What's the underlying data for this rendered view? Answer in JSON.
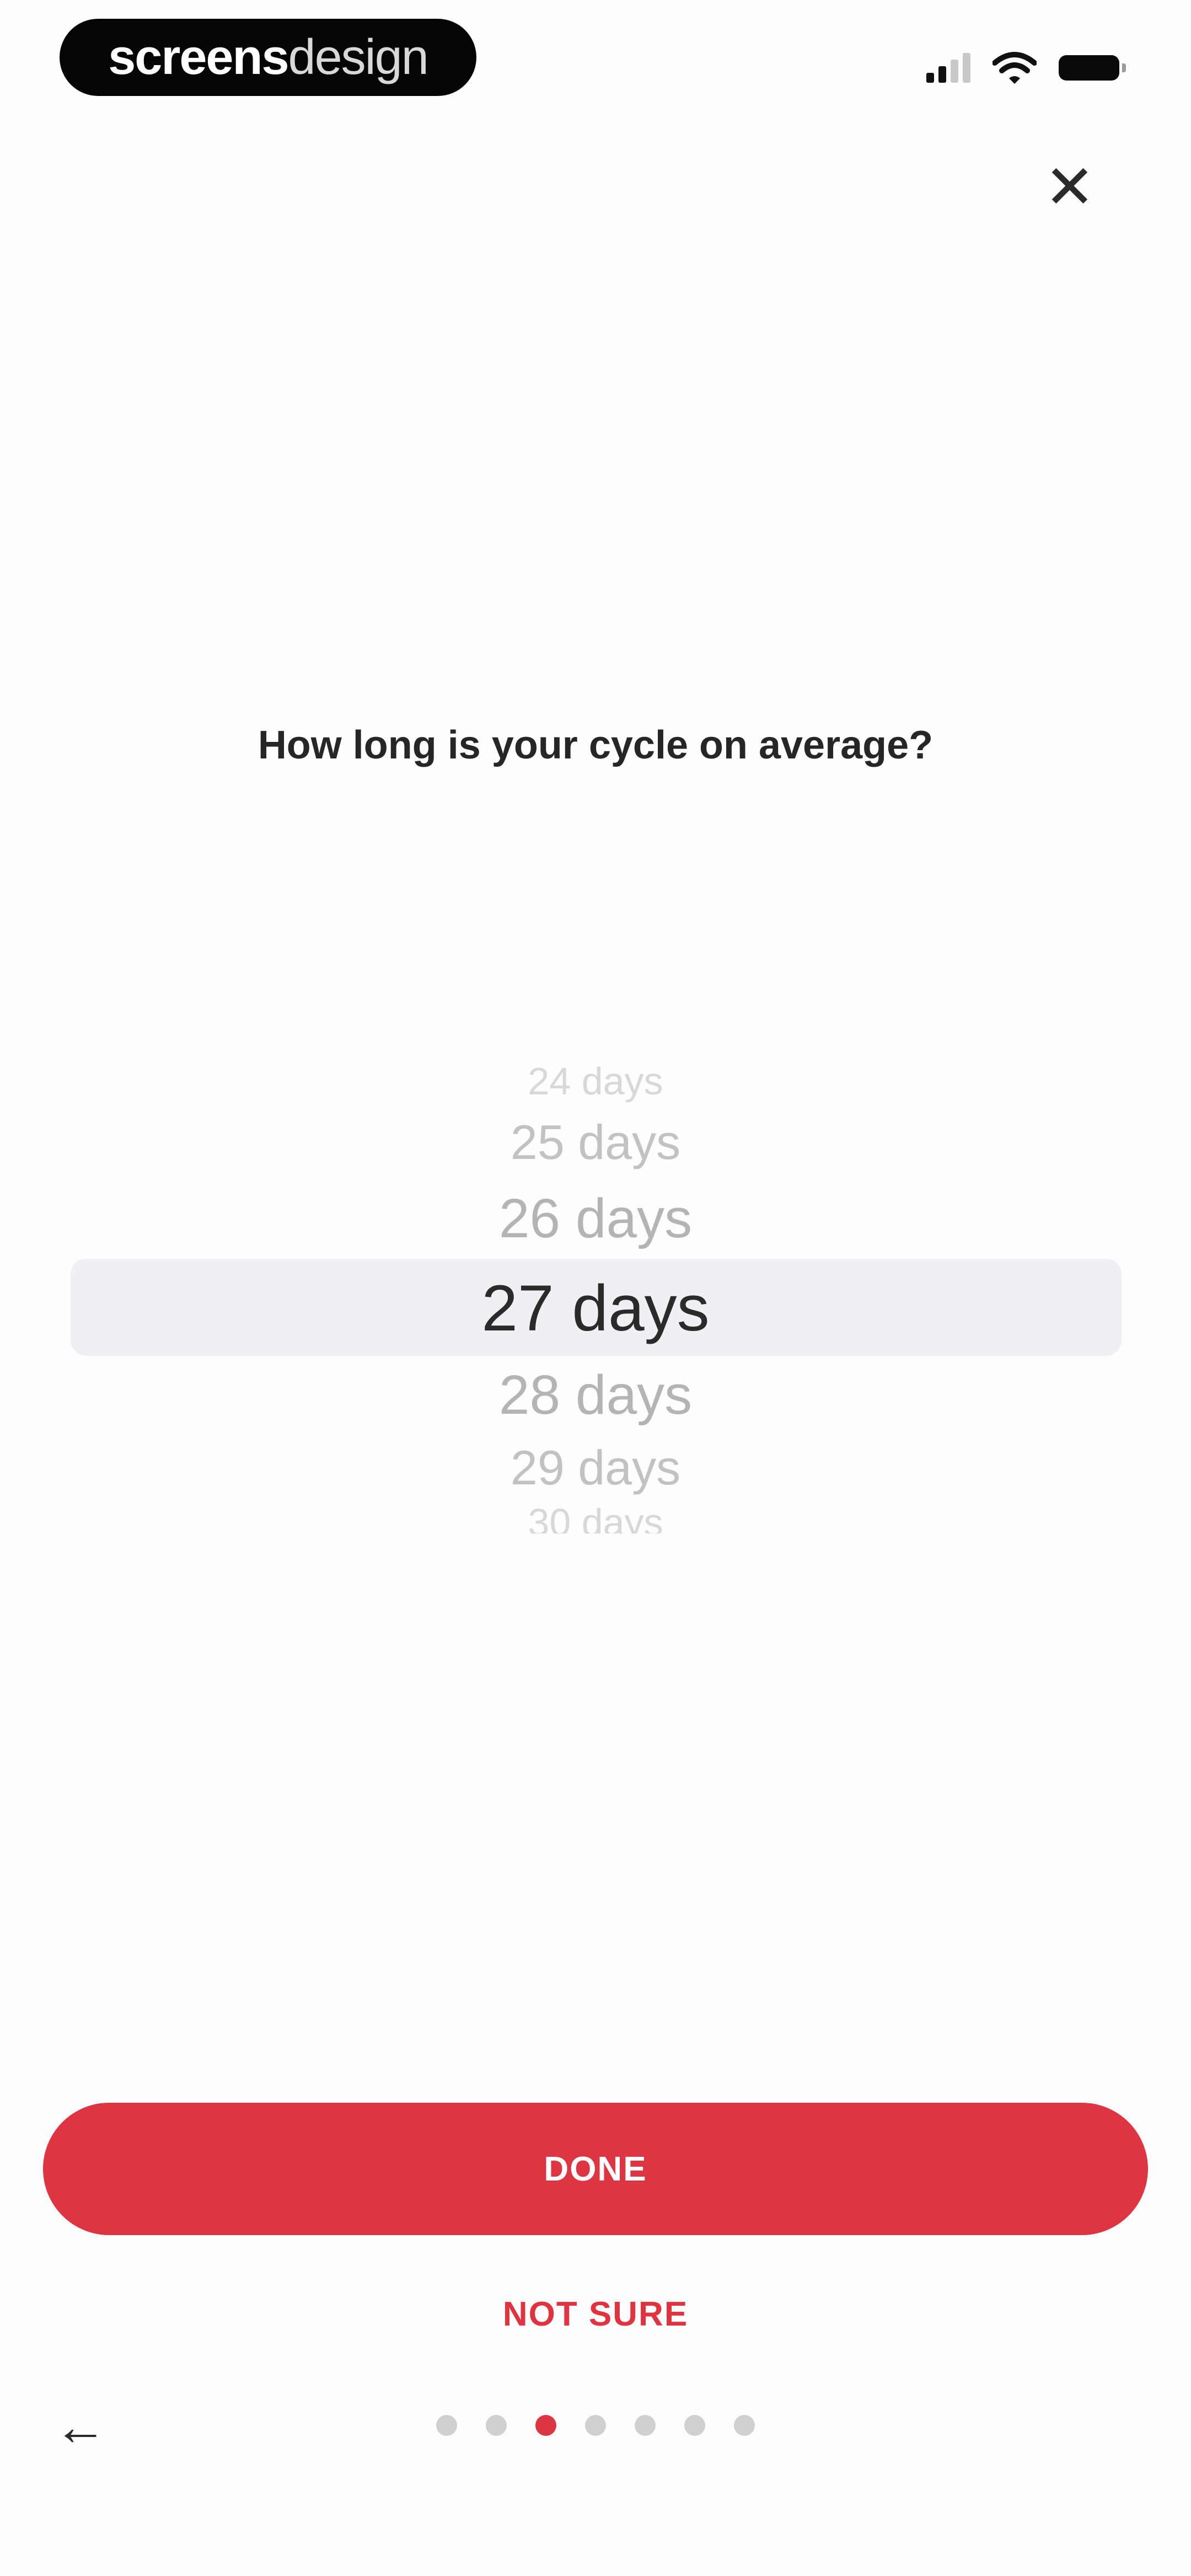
{
  "status_bar": {
    "brand": {
      "part1": "screens",
      "part2": "design"
    },
    "icons": [
      "signal-icon",
      "wifi-icon",
      "battery-icon"
    ]
  },
  "close_icon": "close-icon",
  "question": "How long is your cycle on average?",
  "picker": {
    "items": [
      "24 days",
      "25 days",
      "26 days",
      "27 days",
      "28 days",
      "29 days",
      "30 days"
    ],
    "selected_index": 3
  },
  "actions": {
    "done_label": "DONE",
    "not_sure_label": "NOT SURE"
  },
  "footer": {
    "back_icon": "back-arrow-icon",
    "page_count": 7,
    "current_page": 3
  },
  "colors": {
    "accent": "#de3542",
    "text_dark": "#262626",
    "picker_highlight": "#f0f0f2",
    "dot_inactive": "#d0d0d0"
  }
}
